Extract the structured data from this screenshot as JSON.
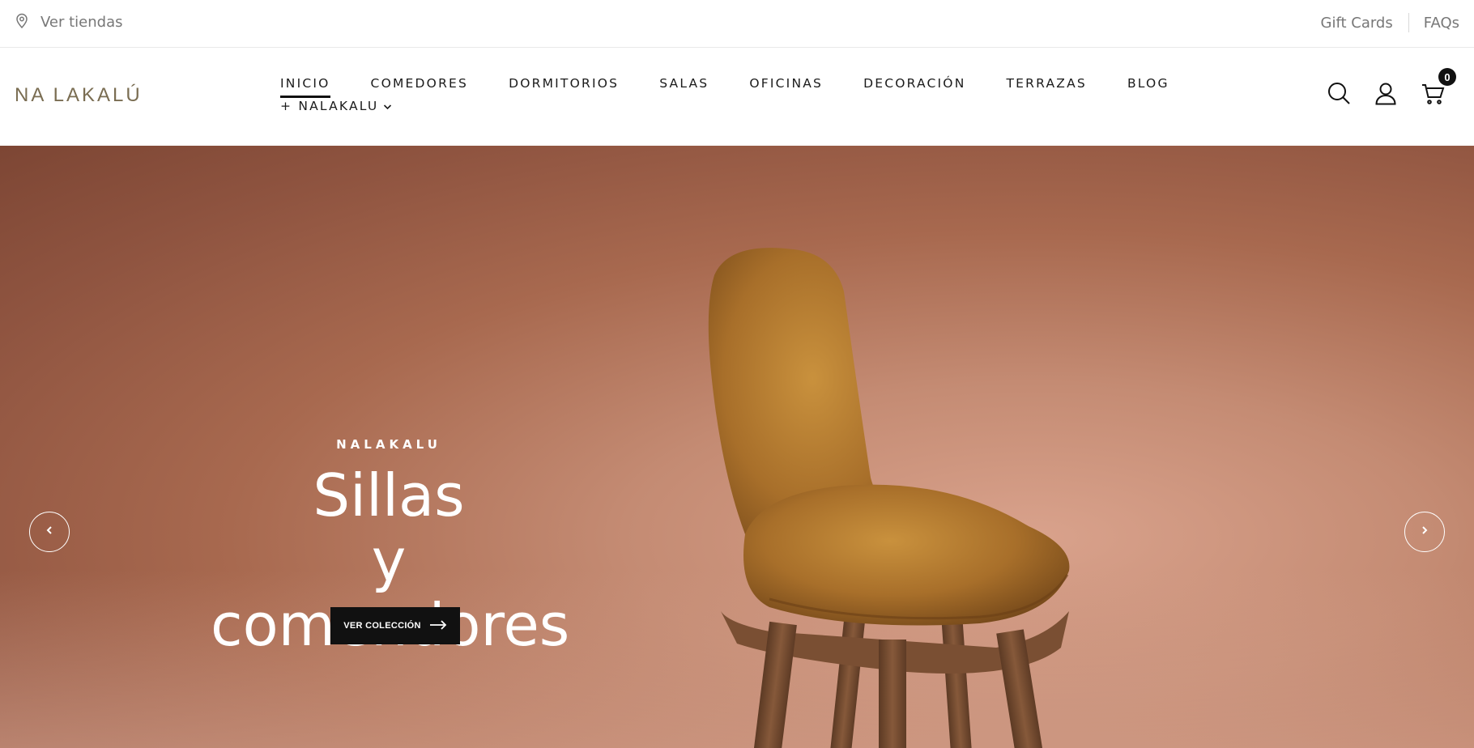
{
  "topbar": {
    "store_link": "Ver tiendas",
    "gift_cards": "Gift Cards",
    "faqs": "FAQs"
  },
  "header": {
    "logo": "NA LAKALÚ",
    "nav": [
      {
        "label": "INICIO",
        "active": true
      },
      {
        "label": "COMEDORES"
      },
      {
        "label": "DORMITORIOS"
      },
      {
        "label": "SALAS"
      },
      {
        "label": "OFICINAS"
      },
      {
        "label": "DECORACIÓN"
      },
      {
        "label": "TERRAZAS"
      },
      {
        "label": "BLOG"
      }
    ],
    "nav_more": "+ NALAKALU",
    "cart_count": "0",
    "icons": [
      "search-icon",
      "user-icon",
      "cart-icon"
    ]
  },
  "hero": {
    "eyebrow": "NALAKALU",
    "headline_line1": "Sillas",
    "headline_line2": "y comendores",
    "cta_label": "VER COLECCIÓN",
    "colors": {
      "background": "#a8694f",
      "cta_background": "#111111",
      "chair_upholstery": "#b07a2e",
      "chair_wood": "#7a4f33"
    }
  }
}
